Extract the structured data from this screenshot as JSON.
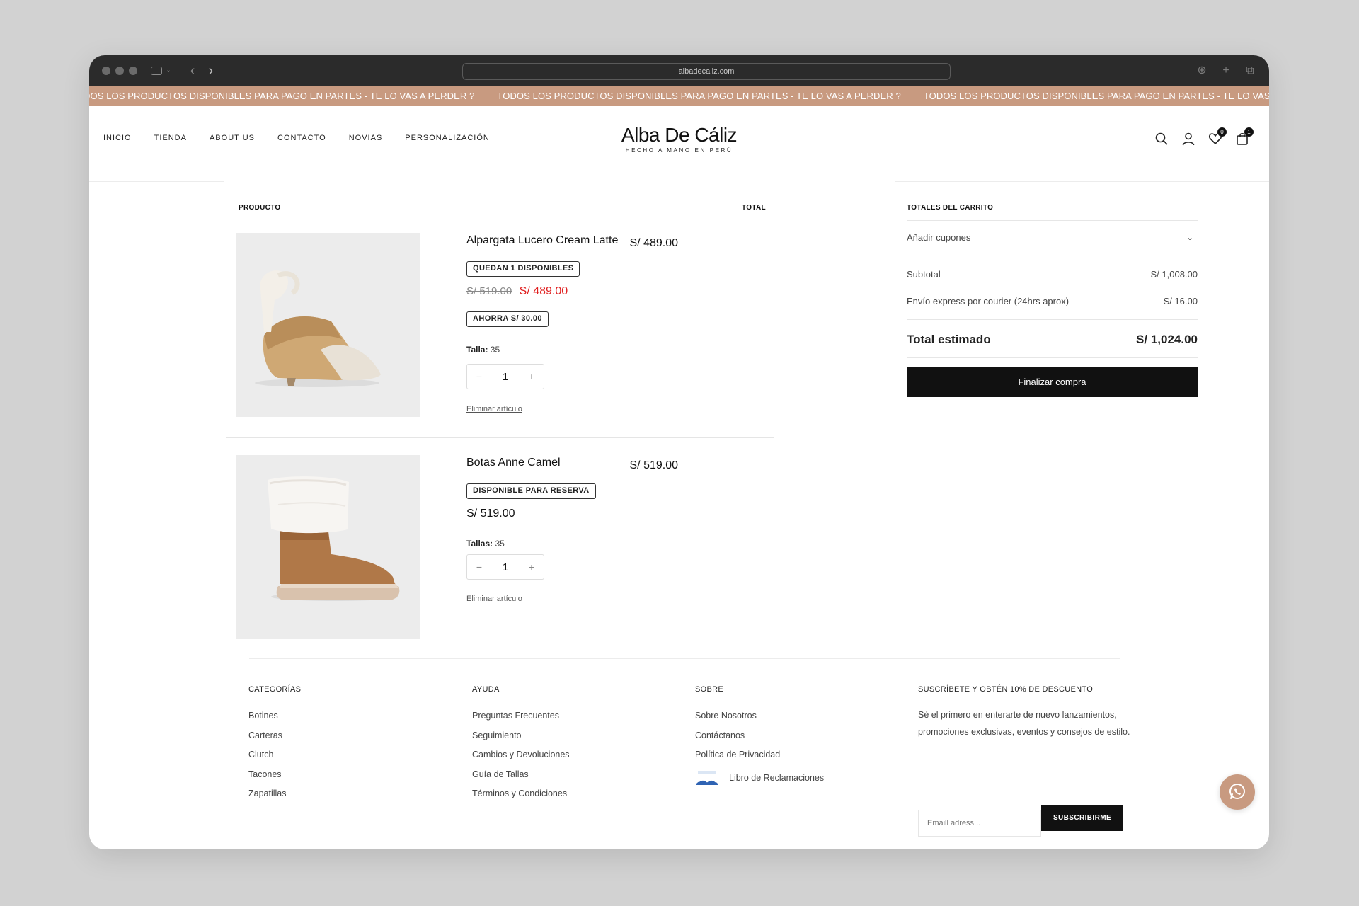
{
  "browser": {
    "url": "albadecaliz.com"
  },
  "announcement": {
    "text": "TODOS LOS PRODUCTOS DISPONIBLES PARA PAGO EN PARTES - TE LO VAS A PERDER ?"
  },
  "header": {
    "nav": [
      "INICIO",
      "TIENDA",
      "ABOUT US",
      "CONTACTO",
      "NOVIAS",
      "PERSONALIZACIÓN"
    ],
    "logo_name": "Alba De Cáliz",
    "logo_tagline": "HECHO A MANO EN PERÚ",
    "wishlist_count": "0",
    "cart_count": "1"
  },
  "cart": {
    "col_product": "PRODUCTO",
    "col_total": "TOTAL",
    "items": [
      {
        "name": "Alpargata Lucero Cream Latte",
        "line_total": "S/ 489.00",
        "stock_tag": "QUEDAN 1 DISPONIBLES",
        "price_old": "S/ 519.00",
        "price": "S/ 489.00",
        "savings_tag": "AHORRA S/ 30.00",
        "size_label": "Talla:",
        "size_value": "35",
        "quantity": "1",
        "remove_label": "Eliminar artículo"
      },
      {
        "name": "Botas Anne Camel",
        "line_total": "S/ 519.00",
        "stock_tag": "DISPONIBLE PARA RESERVA",
        "price": "S/ 519.00",
        "size_label": "Tallas:",
        "size_value": "35",
        "quantity": "1",
        "remove_label": "Eliminar artículo"
      }
    ],
    "qty_minus": "−",
    "qty_plus": "+"
  },
  "totals": {
    "title": "TOTALES DEL CARRITO",
    "coupons_label": "Añadir cupones",
    "subtotal_label": "Subtotal",
    "subtotal_value": "S/ 1,008.00",
    "shipping_label": "Envío express por courier (24hrs aprox)",
    "shipping_value": "S/ 16.00",
    "total_label": "Total estimado",
    "total_value": "S/ 1,024.00",
    "checkout_label": "Finalizar compra"
  },
  "footer": {
    "categories": {
      "title": "CATEGORÍAS",
      "links": [
        "Botines",
        "Carteras",
        "Clutch",
        "Tacones",
        "Zapatillas"
      ]
    },
    "help": {
      "title": "AYUDA",
      "links": [
        "Preguntas Frecuentes",
        "Seguimiento",
        "Cambios y Devoluciones",
        "Guía de Tallas",
        "Términos y Condiciones"
      ]
    },
    "about": {
      "title": "SOBRE",
      "links": [
        "Sobre Nosotros",
        "Contáctanos",
        "Política de Privacidad"
      ],
      "complaints_book": "Libro de Reclamaciones"
    },
    "newsletter": {
      "title": "SUSCRÍBETE Y OBTÉN 10% DE DESCUENTO",
      "text": "Sé el primero en enterarte de nuevo lanzamientos, promociones exclusivas, eventos y consejos de estilo.",
      "placeholder": "Emaill adress...",
      "button": "SUBSCRIBIRME"
    }
  },
  "colors": {
    "accent": "#c89a80",
    "sale": "#e02020",
    "dark": "#111111"
  }
}
